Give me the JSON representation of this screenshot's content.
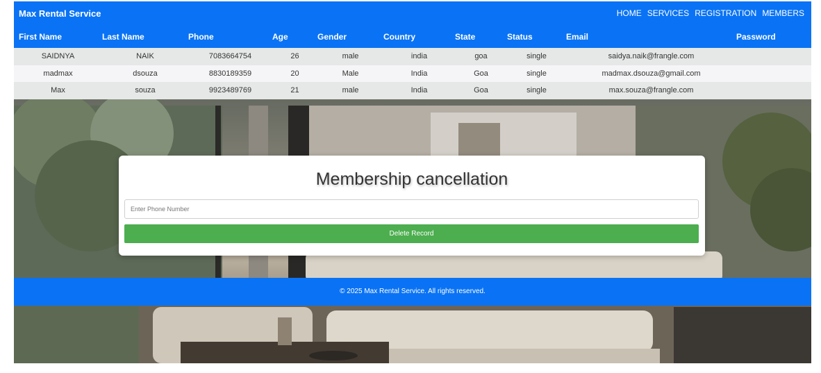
{
  "navbar": {
    "brand": "Max Rental Service",
    "links": [
      "HOME",
      "SERVICES",
      "REGISTRATION",
      "MEMBERS"
    ]
  },
  "table": {
    "headers": [
      "First Name",
      "Last Name",
      "Phone",
      "Age",
      "Gender",
      "Country",
      "State",
      "Status",
      "Email",
      "Password"
    ],
    "rows": [
      [
        "SAIDNYA",
        "NAIK",
        "7083664754",
        "26",
        "male",
        "india",
        "goa",
        "single",
        "saidya.naik@frangle.com",
        ""
      ],
      [
        "madmax",
        "dsouza",
        "8830189359",
        "20",
        "Male",
        "India",
        "Goa",
        "single",
        "madmax.dsouza@gmail.com",
        ""
      ],
      [
        "Max",
        "souza",
        "9923489769",
        "21",
        "male",
        "India",
        "Goa",
        "single",
        "max.souza@frangle.com",
        ""
      ]
    ]
  },
  "card": {
    "title": "Membership cancellation",
    "phone_placeholder": "Enter Phone Number",
    "phone_value": "",
    "delete_label": "Delete Record"
  },
  "footer": {
    "text": "© 2025 Max Rental Service. All rights reserved."
  },
  "colors": {
    "primary": "#0a73f5",
    "button_green": "#4cae4f",
    "row_odd": "#e6e8e8",
    "row_even": "#f5f5f7"
  },
  "background": {
    "image": "living-room-photo"
  }
}
